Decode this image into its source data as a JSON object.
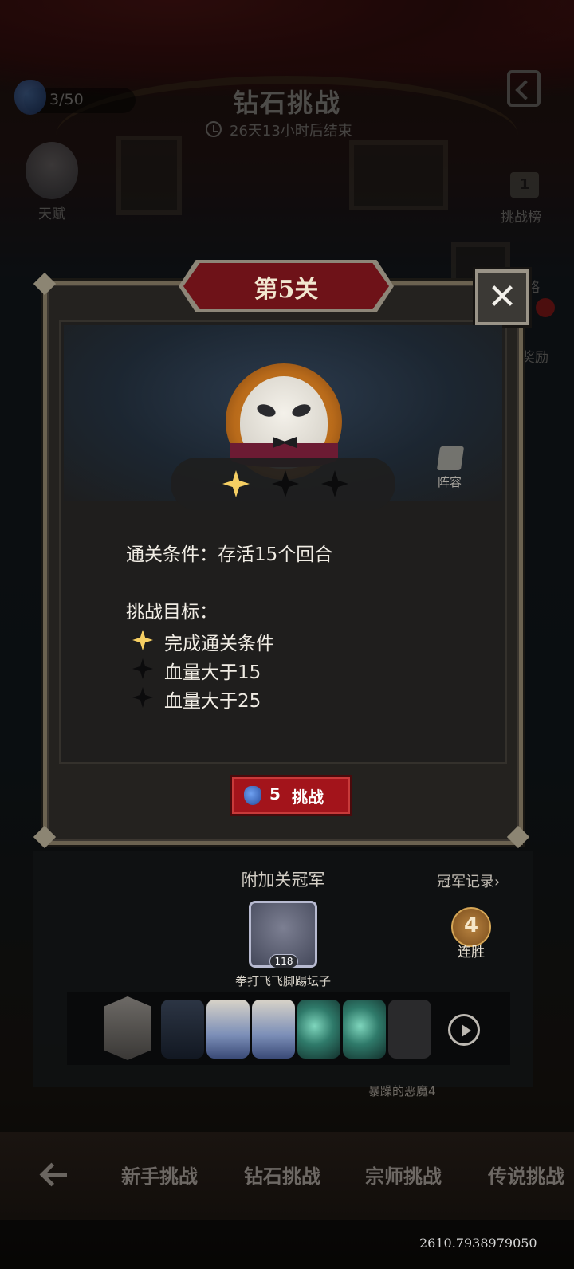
{
  "header": {
    "title": "钻石挑战",
    "countdown": "26天13小时后结束",
    "stamina": "3/50"
  },
  "side": {
    "talent_label": "天赋",
    "ranking_label": "挑战榜",
    "ranking_badge": "1",
    "partial_label_1": "略",
    "partial_label_2": "奖励"
  },
  "modal": {
    "stage_title": "第5关",
    "close_glyph": "✕",
    "lineup_label": "阵容",
    "condition": "通关条件：存活15个回合",
    "goals_title": "挑战目标：",
    "goals": [
      {
        "text": "完成通关条件",
        "achieved": true
      },
      {
        "text": "血量大于15",
        "achieved": false
      },
      {
        "text": "血量大于25",
        "achieved": false
      }
    ],
    "stars_earned": 1,
    "stars_total": 3,
    "challenge_button": {
      "cost": "5",
      "label": "挑战"
    }
  },
  "champion": {
    "title": "附加关冠军",
    "record_link": "冠军记录›",
    "level": "118",
    "name": "拳打飞飞脚踢坛子",
    "streak_count": "4",
    "streak_label": "连胜",
    "team": [
      "leader",
      "top-hat",
      "chef",
      "chef",
      "swirl",
      "swirl",
      "empty"
    ],
    "enemy_label": "暴躁的恶魔4"
  },
  "tabs": [
    "新手挑战",
    "钻石挑战",
    "宗师挑战",
    "传说挑战"
  ],
  "debug_value": "2610.7938979050",
  "colors": {
    "accent_red": "#a3141b",
    "gold_star": "#f6cf63",
    "panel_border": "#6b6250"
  }
}
